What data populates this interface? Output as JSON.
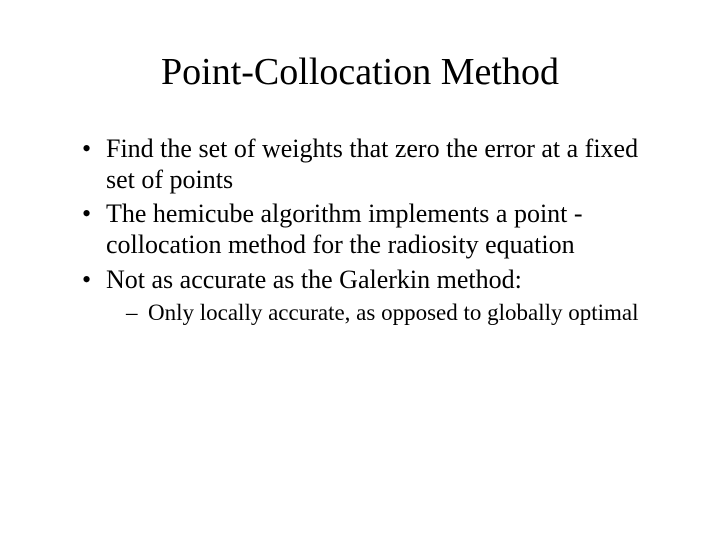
{
  "slide": {
    "title": "Point-Collocation Method",
    "bullets": [
      "Find the set of weights that zero the error at a fixed set of points",
      "The hemicube algorithm implements a point -collocation method for the radiosity equation",
      "Not as accurate as the Galerkin method:"
    ],
    "subbullets": [
      "Only locally accurate, as opposed to globally optimal"
    ]
  }
}
